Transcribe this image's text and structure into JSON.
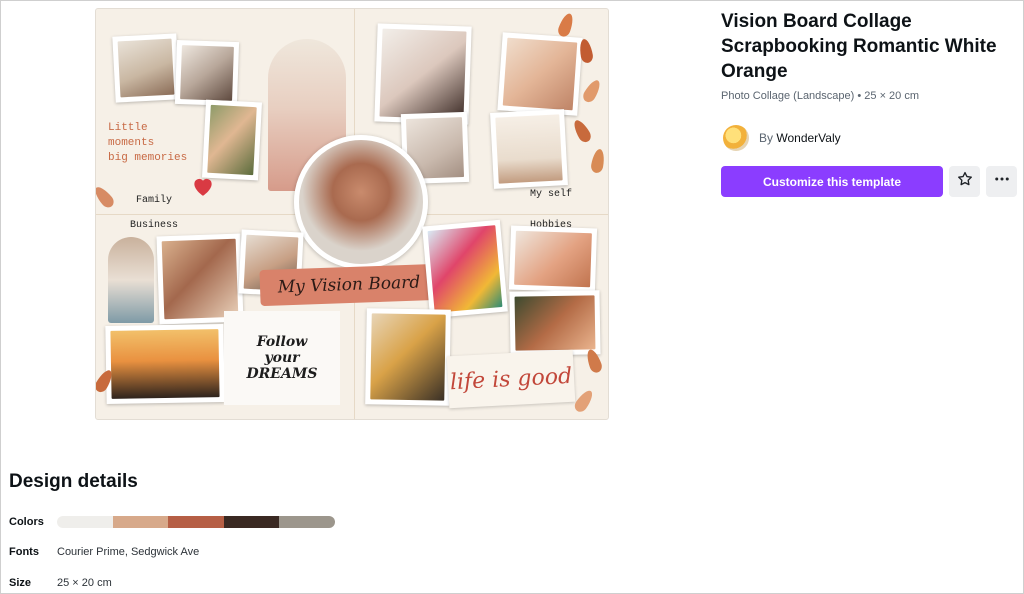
{
  "template": {
    "title": "Vision Board Collage Scrapbooking Romantic White Orange",
    "subtitle": "Photo Collage (Landscape) • 25 × 20 cm",
    "author_prefix": "By",
    "author_name": "WonderValy",
    "customize_label": "Customize this template",
    "star_icon": "star-icon",
    "more_icon": "more-icon"
  },
  "preview": {
    "quote": "Little\nmoments\nbig memories",
    "captions": {
      "family": "Family",
      "myself": "My self",
      "business": "Business",
      "hobbies": "Hobbies"
    },
    "banner": "My Vision Board",
    "follow": "Follow\nyour\nDREAMS",
    "life": "life is good",
    "colors": {
      "background": "#f6f0e7",
      "accent": "#d9826a",
      "heart": "#d93a43"
    }
  },
  "details": {
    "heading": "Design details",
    "colors_label": "Colors",
    "palette": [
      "#efeeeb",
      "#d7a98a",
      "#b65f45",
      "#3a2922",
      "#9c968c"
    ],
    "fonts_label": "Fonts",
    "fonts_value": "Courier Prime, Sedgwick Ave",
    "size_label": "Size",
    "size_value": "25 × 20 cm"
  }
}
